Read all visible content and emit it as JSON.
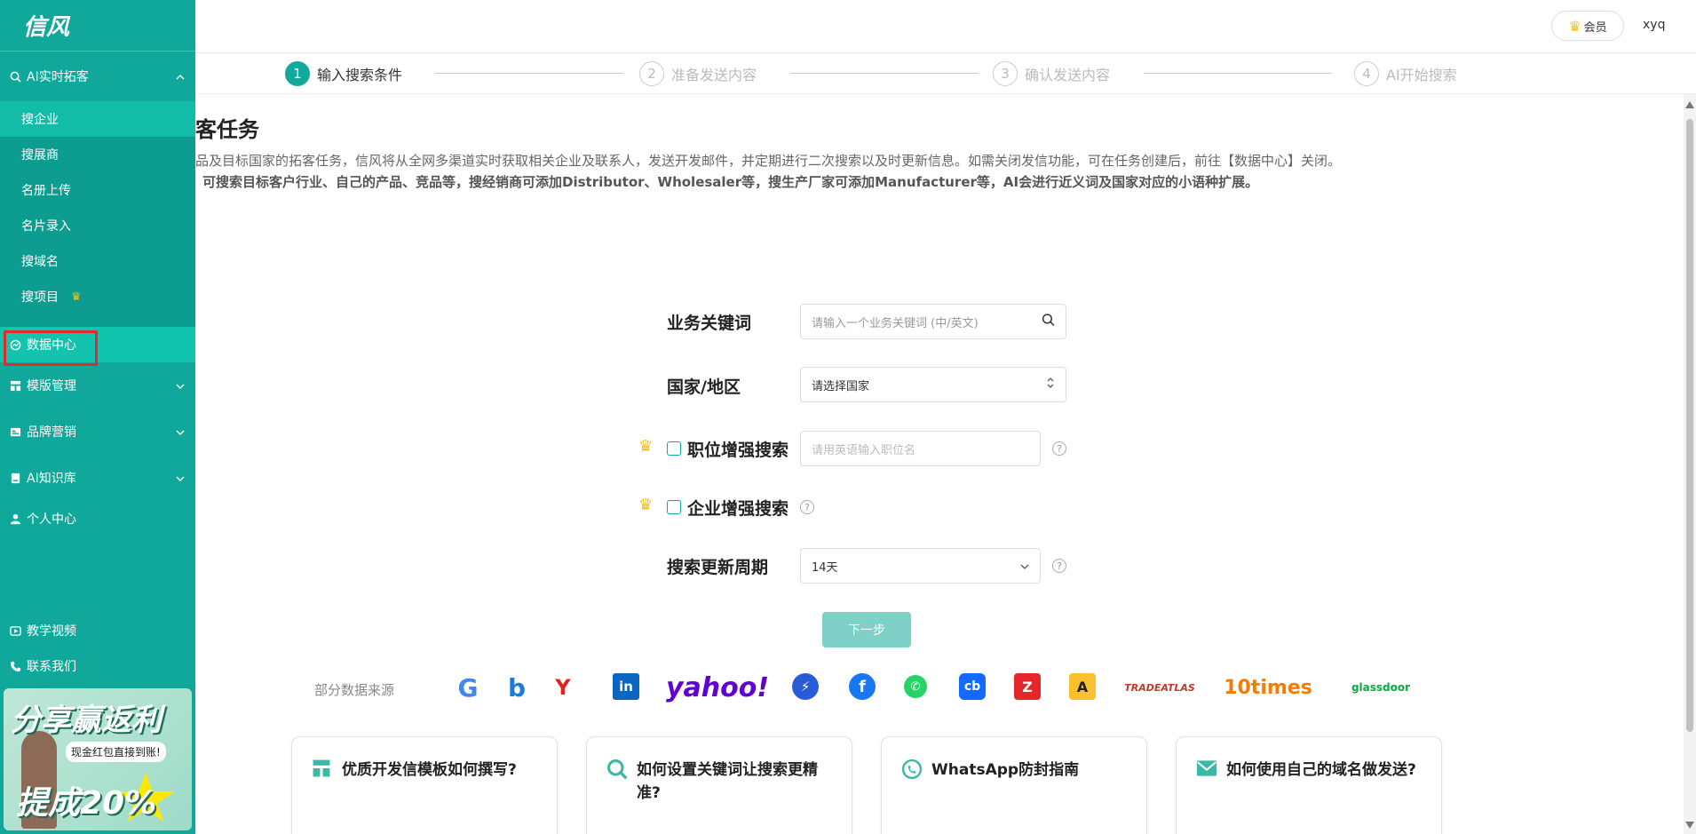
{
  "app": {
    "logo": "信风"
  },
  "sidebar": {
    "group1": {
      "label": "AI实时拓客",
      "chevron": "^"
    },
    "sub_items": [
      {
        "label": "搜企业"
      },
      {
        "label": "搜展商"
      },
      {
        "label": "名册上传"
      },
      {
        "label": "名片录入"
      },
      {
        "label": "搜域名"
      },
      {
        "label": "搜项目"
      }
    ],
    "data_center": "数据中心",
    "template_mgmt": "模版管理",
    "brand_marketing": "品牌营销",
    "knowledge_base": "AI知识库",
    "personal_center": "个人中心",
    "tutorial": "教学视频",
    "contact": "联系我们",
    "banner": {
      "line1": "分享赢返利",
      "line2": "现金红包直接到账!",
      "line3": "提成20%"
    }
  },
  "header": {
    "vip_label": "会员",
    "username": "xyq"
  },
  "steps": [
    {
      "num": "1",
      "label": "输入搜索条件"
    },
    {
      "num": "2",
      "label": "准备发送内容"
    },
    {
      "num": "3",
      "label": "确认发送内容"
    },
    {
      "num": "4",
      "label": "AI开始搜索"
    }
  ],
  "main": {
    "title": "客任务",
    "desc1": "品及目标国家的拓客任务，信风将从全网多渠道实时获取相关企业及联系人，发送开发邮件，并定期进行二次搜索以及时更新信息。如需关闭发信功能，可在任务创建后，前往【数据中心】关闭。",
    "desc2": "可搜索目标客户行业、自己的产品、竞品等，搜经销商可添加Distributor、Wholesaler等，搜生产厂家可添加Manufacturer等，AI会进行近义词及国家对应的小语种扩展。"
  },
  "form": {
    "keyword_label": "业务关键词",
    "keyword_placeholder": "请输入一个业务关键词 (中/英文)",
    "country_label": "国家/地区",
    "country_value": "请选择国家",
    "position_label": "职位增强搜索",
    "position_placeholder": "请用英语输入职位名",
    "company_label": "企业增强搜索",
    "cycle_label": "搜索更新周期",
    "cycle_value": "14天",
    "next_button": "下一步",
    "help_glyph": "?"
  },
  "sources": {
    "label": "部分数据来源",
    "items": [
      "G",
      "b",
      "Y",
      "in",
      "yahoo!",
      "⚡",
      "f",
      "✆",
      "cb",
      "Z",
      "A",
      "TRADEATLAS",
      "10times",
      "glassdoor"
    ]
  },
  "cards": [
    {
      "text": "优质开发信模板如何撰写?",
      "icon": "template-icon"
    },
    {
      "text": "如何设置关键词让搜索更精准?",
      "icon": "search-icon"
    },
    {
      "text": "WhatsApp防封指南",
      "icon": "whatsapp-icon"
    },
    {
      "text": "如何使用自己的域名做发送?",
      "icon": "mail-icon"
    }
  ],
  "colors": {
    "primary": "#0fa89b",
    "highlight": "#12c4ad",
    "crown": "#f4c20d",
    "alert_box": "#e12a2a"
  }
}
